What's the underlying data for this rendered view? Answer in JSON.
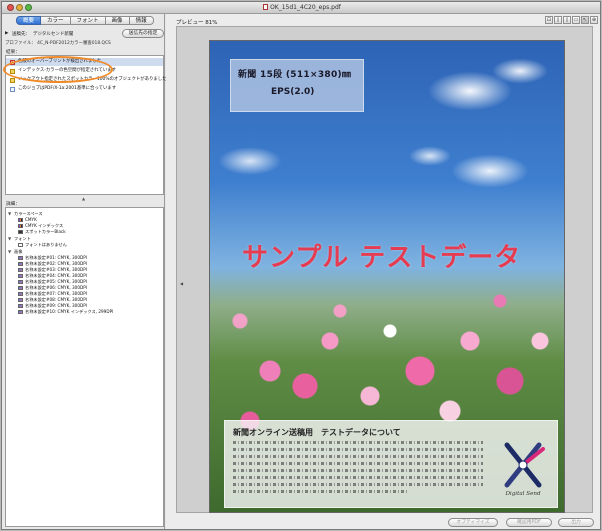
{
  "window": {
    "title": "OK_15d1_4C20_eps.pdf"
  },
  "tabs": [
    {
      "label": "概要",
      "active": true
    },
    {
      "label": "カラー",
      "active": false
    },
    {
      "label": "フォント",
      "active": false
    },
    {
      "label": "画像",
      "active": false
    },
    {
      "label": "情報",
      "active": false
    }
  ],
  "destination": {
    "label": "送稿先：",
    "value": "デジタルセンド新聞",
    "button": "送信先の指定"
  },
  "profile_text": "プロファイル： 4C_N-PDF2012カラー審査018.QCS",
  "results": {
    "title": "結果：",
    "items": [
      {
        "text": "色版のオーバープリントが検出されました",
        "status": "error"
      },
      {
        "text": "インデックス-カラーの色空間が指定されています",
        "status": "warn"
      },
      {
        "text": "ノックアウト指定されたスポットカラー100%のオブジェクトがありました",
        "status": "warn"
      },
      {
        "text": "このジョブはPDF/X-1a:2001基準に合っています",
        "status": "ok"
      }
    ]
  },
  "details": {
    "title": "詳細：",
    "tree": [
      {
        "text": "カラースペース",
        "level": 0,
        "type": "group"
      },
      {
        "text": "CMYK",
        "level": 1,
        "type": "cmyk"
      },
      {
        "text": "CMYK インデックス",
        "level": 1,
        "type": "cmyk"
      },
      {
        "text": "スポットカラーBlack",
        "level": 1,
        "type": "spot"
      },
      {
        "text": "フォント",
        "level": 0,
        "type": "group"
      },
      {
        "text": "フォントはありません",
        "level": 1,
        "type": "font"
      },
      {
        "text": "画像",
        "level": 0,
        "type": "group"
      },
      {
        "text": "名称未設定#01: CMYK, 300DPI",
        "level": 1,
        "type": "img"
      },
      {
        "text": "名称未設定#02: CMYK, 300DPI",
        "level": 1,
        "type": "img"
      },
      {
        "text": "名称未設定#03: CMYK, 300DPI",
        "level": 1,
        "type": "img"
      },
      {
        "text": "名称未設定#04: CMYK, 300DPI",
        "level": 1,
        "type": "img"
      },
      {
        "text": "名称未設定#05: CMYK, 300DPI",
        "level": 1,
        "type": "img"
      },
      {
        "text": "名称未設定#06: CMYK, 300DPI",
        "level": 1,
        "type": "img"
      },
      {
        "text": "名称未設定#07: CMYK, 300DPI",
        "level": 1,
        "type": "img"
      },
      {
        "text": "名称未設定#08: CMYK, 300DPI",
        "level": 1,
        "type": "img"
      },
      {
        "text": "名称未設定#09: CMYK, 300DPI",
        "level": 1,
        "type": "img"
      },
      {
        "text": "名称未設定#10: CMYK インデックス, 299DPI",
        "level": 1,
        "type": "img"
      }
    ]
  },
  "preview": {
    "label": "プレビュー 81%",
    "spec_line1": "新聞 15段 (511×380)㎜",
    "spec_line2": "EPS(2.0)",
    "sample_text": "サンプル テストデータ",
    "info_title": "新聞オンライン送稿用　テストデータについて",
    "logo_text": "Digital Send"
  },
  "toolbar": {
    "icons": [
      "zoom-fit-icon",
      "single-page-icon",
      "two-page-icon",
      "page-icon",
      "pointer-icon",
      "zoom-icon"
    ]
  },
  "bottom_buttons": {
    "optimize": "オプティマイズ",
    "proof_pdf": "確認用PDF",
    "output": "出力"
  },
  "colors": {
    "accent_tab": "#2f6fd3",
    "highlight": "#f08a28",
    "sample_text": "#e63c52"
  }
}
